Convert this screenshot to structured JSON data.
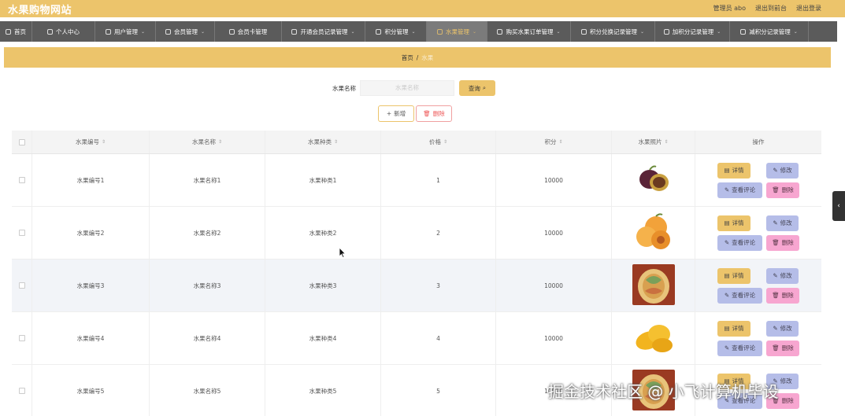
{
  "header": {
    "site_title": "水果购物网站",
    "admin_label": "管理员 abo",
    "to_front": "退出到前台",
    "logout": "退出登录"
  },
  "nav": [
    {
      "label": "首页",
      "icon": "home-icon",
      "active": false
    },
    {
      "label": "个人中心",
      "icon": "user-icon",
      "active": false
    },
    {
      "label": "用户管理",
      "icon": "user-icon",
      "active": false
    },
    {
      "label": "会员管理",
      "icon": "clock-icon",
      "active": false
    },
    {
      "label": "会员卡管理",
      "icon": "expand-icon",
      "active": false
    },
    {
      "label": "开通会员记录管理",
      "icon": "gear-icon",
      "active": false
    },
    {
      "label": "积分管理",
      "icon": "list-icon",
      "active": false
    },
    {
      "label": "水果管理",
      "icon": "list-icon",
      "active": true
    },
    {
      "label": "购买水果订单管理",
      "icon": "bank-icon",
      "active": false
    },
    {
      "label": "积分兑换记录管理",
      "icon": "card-icon",
      "active": false
    },
    {
      "label": "加积分记录管理",
      "icon": "doc-icon",
      "active": false
    },
    {
      "label": "减积分记录管理",
      "icon": "list-icon",
      "active": false
    }
  ],
  "breadcrumb": {
    "home": "首页",
    "separator": "/",
    "current": "水果"
  },
  "search": {
    "label": "水果名称",
    "placeholder": "水果名称",
    "button": "查询"
  },
  "actions": {
    "add": "新增",
    "delete": "删除"
  },
  "table": {
    "columns": [
      "水果编号",
      "水果名称",
      "水果种类",
      "价格",
      "积分",
      "水果照片",
      "操作"
    ],
    "rows": [
      {
        "code": "水果编号1",
        "name": "水果名称1",
        "kind": "水果种类1",
        "price": "1",
        "points": "10000",
        "photo": "passion-fruit"
      },
      {
        "code": "水果编号2",
        "name": "水果名称2",
        "kind": "水果种类2",
        "price": "2",
        "points": "10000",
        "photo": "apricot"
      },
      {
        "code": "水果编号3",
        "name": "水果名称3",
        "kind": "水果种类3",
        "price": "3",
        "points": "10000",
        "photo": "carved-melon"
      },
      {
        "code": "水果编号4",
        "name": "水果名称4",
        "kind": "水果种类4",
        "price": "4",
        "points": "10000",
        "photo": "mango"
      },
      {
        "code": "水果编号5",
        "name": "水果名称5",
        "kind": "水果种类5",
        "price": "5",
        "points": "10000",
        "photo": "carved-melon"
      }
    ],
    "ops": {
      "detail": "详情",
      "edit": "修改",
      "review": "查看评论",
      "delete": "删除"
    }
  },
  "watermark": "掘金技术社区 @ 小飞计算机毕设",
  "colors": {
    "accent": "#ecc46b",
    "nav_bg": "#5b5b5b",
    "edit_btn": "#b5bde8",
    "delete_btn": "#f7a6d0"
  }
}
